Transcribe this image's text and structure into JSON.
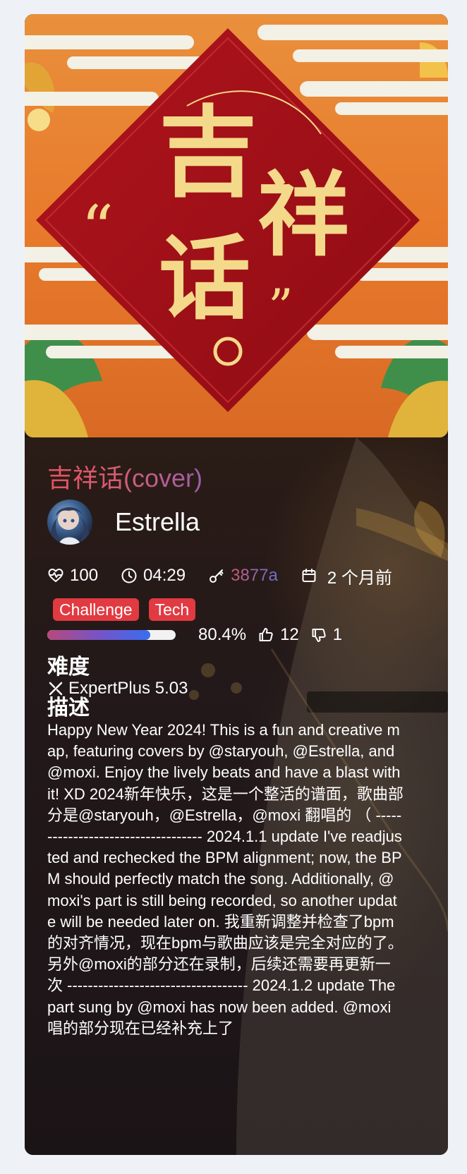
{
  "map": {
    "title": "吉祥话(cover)",
    "cover_text": "吉祥话",
    "mapper": "Estrella",
    "stats": {
      "upvote_score": "100",
      "duration": "04:29",
      "key": "3877a",
      "uploaded": "2 个月前"
    },
    "tags": [
      "Challenge",
      "Tech"
    ],
    "rating": {
      "percent_label": "80.4%",
      "percent_value": 80.4,
      "upvotes": "12",
      "downvotes": "1"
    },
    "difficulty_heading": "难度",
    "difficulty": "ExpertPlus 5.03",
    "description_heading": "描述",
    "description": "Happy New Year 2024! This is a fun and creative map, featuring covers by @staryouh, @Estrella, and @moxi. Enjoy the lively beats and have a blast with it! XD 2024新年快乐，这是一个整活的谱面，歌曲部分是@staryouh，@Estrella，@moxi 翻唱的 （ ----------------------------------- 2024.1.1 update I've readjusted and rechecked the BPM alignment; now, the BPM should perfectly match the song. Additionally, @moxi's part is still being recorded, so another update will be needed later on. 我重新调整并检查了bpm的对齐情况，现在bpm与歌曲应该是完全对应的了。另外@moxi的部分还在录制，后续还需要再更新一次 ----------------------------------- 2024.1.2 update The part sung by @moxi has now been added. @moxi 唱的部分现在已经补充上了"
  },
  "colors": {
    "tag_bg": "#e23a42",
    "title_gradient": [
      "#e8525f",
      "#9a5fa8"
    ],
    "bar_gradient": [
      "#b7497c",
      "#3a6df0"
    ],
    "page_bg": "#eef1f6"
  },
  "icons": {
    "score": "heart-pulse-icon",
    "duration": "clock-icon",
    "key": "key-icon",
    "uploaded": "calendar-icon",
    "upvote": "thumbs-up-icon",
    "downvote": "thumbs-down-icon",
    "difficulty": "saber-icon"
  }
}
